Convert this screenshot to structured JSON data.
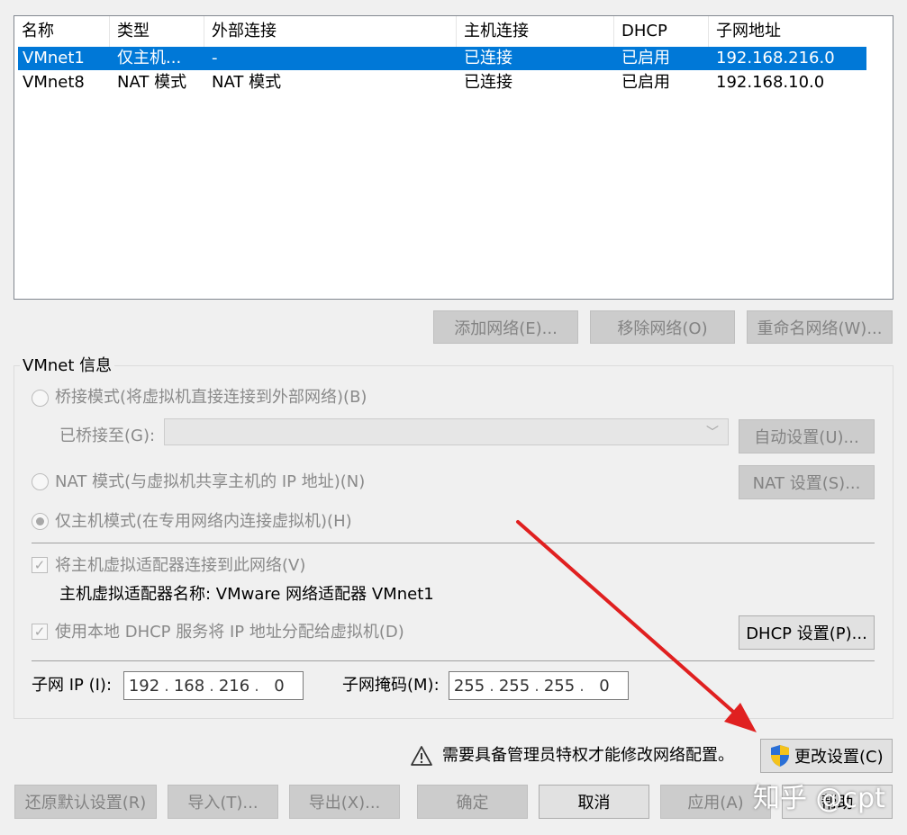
{
  "table": {
    "headers": [
      "名称",
      "类型",
      "外部连接",
      "主机连接",
      "DHCP",
      "子网地址"
    ],
    "rows": [
      {
        "name": "VMnet1",
        "type": "仅主机...",
        "external": "-",
        "host": "已连接",
        "dhcp": "已启用",
        "subnet": "192.168.216.0"
      },
      {
        "name": "VMnet8",
        "type": "NAT 模式",
        "external": "NAT 模式",
        "host": "已连接",
        "dhcp": "已启用",
        "subnet": "192.168.10.0"
      }
    ]
  },
  "network_buttons": {
    "add": "添加网络(E)...",
    "remove": "移除网络(O)",
    "rename": "重命名网络(W)..."
  },
  "vmnet_info": {
    "title": "VMnet 信息",
    "bridged_label": "桥接模式(将虚拟机直接连接到外部网络)(B)",
    "bridged_to_label": "已桥接至(G):",
    "bridged_to_value": "",
    "auto_settings": "自动设置(U)...",
    "nat_label": "NAT 模式(与虚拟机共享主机的 IP 地址)(N)",
    "nat_settings": "NAT 设置(S)...",
    "host_only_label": "仅主机模式(在专用网络内连接虚拟机)(H)",
    "connect_adapter_label": "将主机虚拟适配器连接到此网络(V)",
    "adapter_name_label": "主机虚拟适配器名称: VMware 网络适配器 VMnet1",
    "dhcp_label": "使用本地 DHCP 服务将 IP 地址分配给虚拟机(D)",
    "dhcp_settings": "DHCP 设置(P)...",
    "subnet_ip_label": "子网 IP (I):",
    "subnet_ip": [
      "192",
      "168",
      "216",
      "0"
    ],
    "subnet_mask_label": "子网掩码(M):",
    "subnet_mask": [
      "255",
      "255",
      "255",
      "0"
    ]
  },
  "admin": {
    "notice": "需要具备管理员特权才能修改网络配置。",
    "icon": "warning-triangle-icon",
    "change_settings": "更改设置(C)"
  },
  "footer": {
    "restore_defaults": "还原默认设置(R)",
    "import": "导入(T)...",
    "export": "导出(X)...",
    "ok": "确定",
    "cancel": "取消",
    "apply": "应用(A)",
    "help": "帮助"
  },
  "watermark": "知乎 @cpt",
  "colors": {
    "selection": "#0078d7",
    "annotation_arrow": "#e02020"
  }
}
